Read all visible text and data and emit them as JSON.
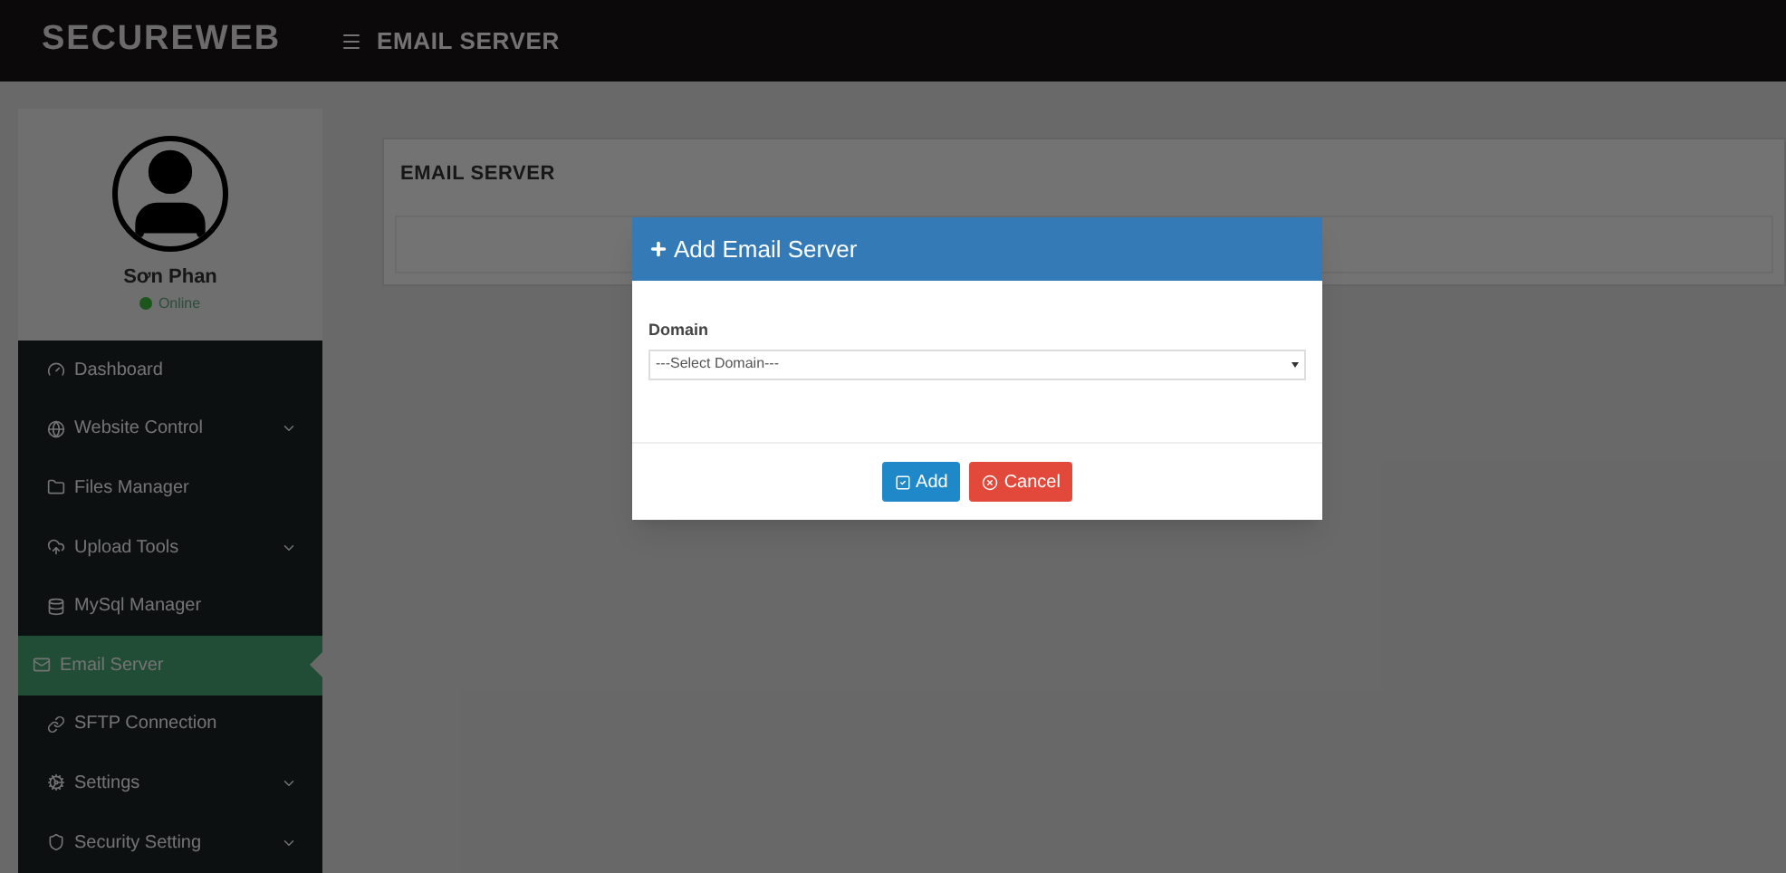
{
  "header": {
    "brand": "SECUREWEB",
    "page_title": "EMAIL SERVER"
  },
  "profile": {
    "name": "Sơn Phan",
    "status": "Online",
    "online": true
  },
  "sidebar": {
    "items": [
      {
        "label": "Dashboard",
        "expandable": false,
        "selected": false
      },
      {
        "label": "Website Control",
        "expandable": true,
        "selected": false
      },
      {
        "label": "Files Manager",
        "expandable": false,
        "selected": false
      },
      {
        "label": "Upload Tools",
        "expandable": true,
        "selected": false
      },
      {
        "label": "MySql Manager",
        "expandable": false,
        "selected": false
      },
      {
        "label": "Email Server",
        "expandable": false,
        "selected": true
      },
      {
        "label": "SFTP Connection",
        "expandable": false,
        "selected": false
      },
      {
        "label": "Settings",
        "expandable": true,
        "selected": false
      },
      {
        "label": "Security Setting",
        "expandable": true,
        "selected": false
      }
    ]
  },
  "content": {
    "card_title": "EMAIL SERVER"
  },
  "modal": {
    "title": "Add Email Server",
    "field_label": "Domain",
    "select_value": "---Select Domain---",
    "buttons": [
      {
        "label": "Add",
        "kind": "primary"
      },
      {
        "label": "Cancel",
        "kind": "danger"
      }
    ]
  }
}
